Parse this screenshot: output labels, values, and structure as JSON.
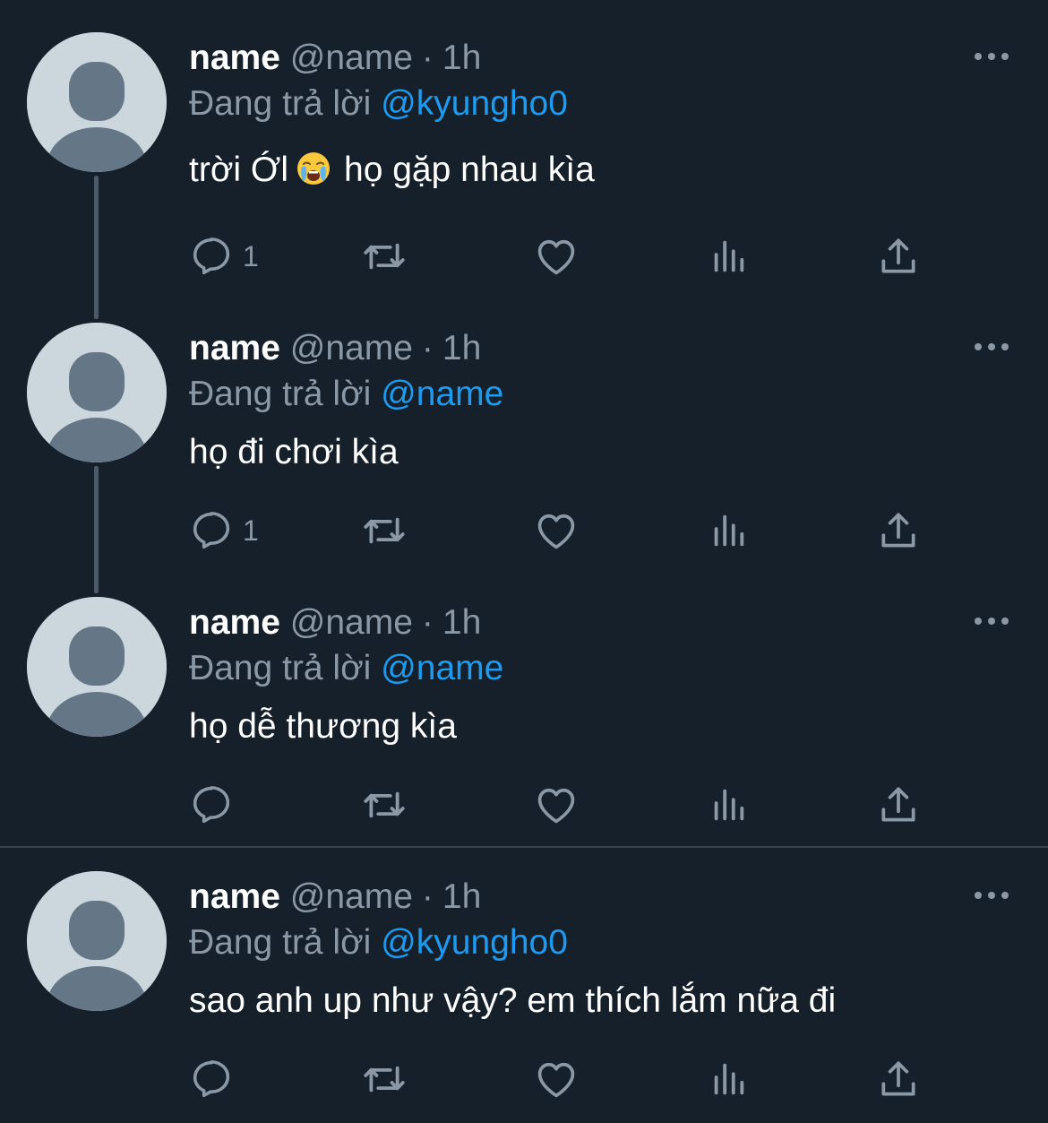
{
  "colors": {
    "background": "#15202b",
    "text_primary": "#ffffff",
    "text_secondary": "#8b98a5",
    "accent": "#1d9bf0",
    "thread_line": "#4c5a68",
    "separator": "#38444d",
    "avatar_bg": "#ccd6dd",
    "avatar_fg": "#657786"
  },
  "icons": {
    "reply": "reply-icon",
    "retweet": "retweet-icon",
    "like": "heart-icon",
    "views": "views-icon",
    "share": "share-icon",
    "more": "more-icon",
    "emoji": "loudly-crying-face-emoji"
  },
  "tweets": [
    {
      "name": "name",
      "handle": "@name",
      "dot": "·",
      "time": "1h",
      "reply_prefix": "Đang trả lời",
      "reply_to": "@kyungho0",
      "text_before_emoji": "trời Ớl",
      "emoji": "😭",
      "text_after_emoji": "họ gặp nhau kìa",
      "reply_count": "1"
    },
    {
      "name": "name",
      "handle": "@name",
      "dot": "·",
      "time": "1h",
      "reply_prefix": "Đang trả lời",
      "reply_to": "@name",
      "text": "họ đi chơi kìa",
      "reply_count": "1"
    },
    {
      "name": "name",
      "handle": "@name",
      "dot": "·",
      "time": "1h",
      "reply_prefix": "Đang trả lời",
      "reply_to": "@name",
      "text": "họ dễ thương kìa",
      "reply_count": ""
    },
    {
      "name": "name",
      "handle": "@name",
      "dot": "·",
      "time": "1h",
      "reply_prefix": "Đang trả lời",
      "reply_to": "@kyungho0",
      "text": "sao anh up như vậy? em thích lắm nữa đi",
      "reply_count": ""
    }
  ]
}
